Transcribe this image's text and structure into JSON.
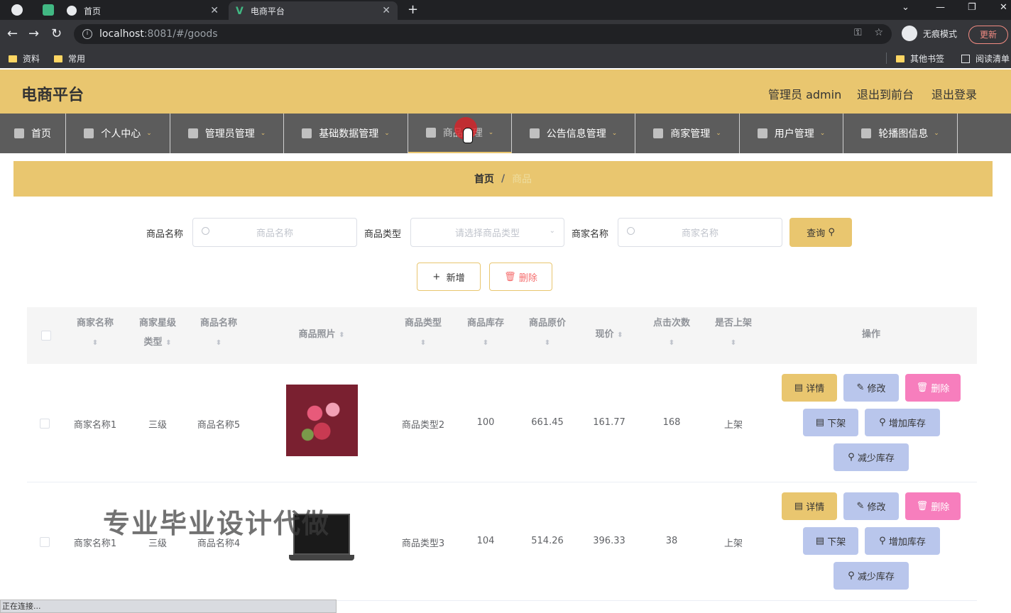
{
  "browser": {
    "tabs": [
      {
        "title": "首页"
      },
      {
        "title": "电商平台"
      }
    ],
    "url_host": "localhost",
    "url_rest": ":8081/#/goods",
    "incognito_label": "无痕模式",
    "update_label": "更新",
    "bookmarks": [
      "资料",
      "常用"
    ],
    "bookmarks_right": [
      "其他书签",
      "阅读清单"
    ]
  },
  "header": {
    "title": "电商平台",
    "user": "管理员 admin",
    "to_front": "退出到前台",
    "logout": "退出登录"
  },
  "menu": [
    {
      "label": "首页"
    },
    {
      "label": "个人中心"
    },
    {
      "label": "管理员管理"
    },
    {
      "label": "基础数据管理"
    },
    {
      "label": "商品管理"
    },
    {
      "label": "公告信息管理"
    },
    {
      "label": "商家管理"
    },
    {
      "label": "用户管理"
    },
    {
      "label": "轮播图信息"
    }
  ],
  "breadcrumb": {
    "home": "首页",
    "sep": "/",
    "current": "商品"
  },
  "search": {
    "goods_name_label": "商品名称",
    "goods_name_placeholder": "商品名称",
    "goods_type_label": "商品类型",
    "goods_type_placeholder": "请选择商品类型",
    "shop_name_label": "商家名称",
    "shop_name_placeholder": "商家名称",
    "query_label": "查询"
  },
  "actions": {
    "add_label": "新增",
    "delete_label": "删除"
  },
  "table": {
    "headers": {
      "shop_name": "商家名称",
      "shop_star_1": "商家星级",
      "shop_star_2": "类型",
      "goods_name": "商品名称",
      "goods_photo": "商品照片",
      "goods_type": "商品类型",
      "stock": "商品库存",
      "orig_price": "商品原价",
      "price": "现价",
      "clicks": "点击次数",
      "on_shelf": "是否上架",
      "ops": "操作"
    },
    "rows": [
      {
        "shop_name": "商家名称1",
        "star": "三级",
        "goods_name": "商品名称5",
        "photo": "flowers",
        "goods_type": "商品类型2",
        "stock": "100",
        "orig_price": "661.45",
        "price": "161.77",
        "clicks": "168",
        "on_shelf": "上架"
      },
      {
        "shop_name": "商家名称1",
        "star": "三级",
        "goods_name": "商品名称4",
        "photo": "laptop",
        "goods_type": "商品类型3",
        "stock": "104",
        "orig_price": "514.26",
        "price": "396.33",
        "clicks": "38",
        "on_shelf": "上架"
      }
    ],
    "op_labels": {
      "detail": "详情",
      "edit": "修改",
      "remove": "删除",
      "down": "下架",
      "add_stock": "增加库存",
      "sub_stock": "减少库存"
    }
  },
  "watermark": "专业毕业设计代做",
  "status_text": "正在连接..."
}
